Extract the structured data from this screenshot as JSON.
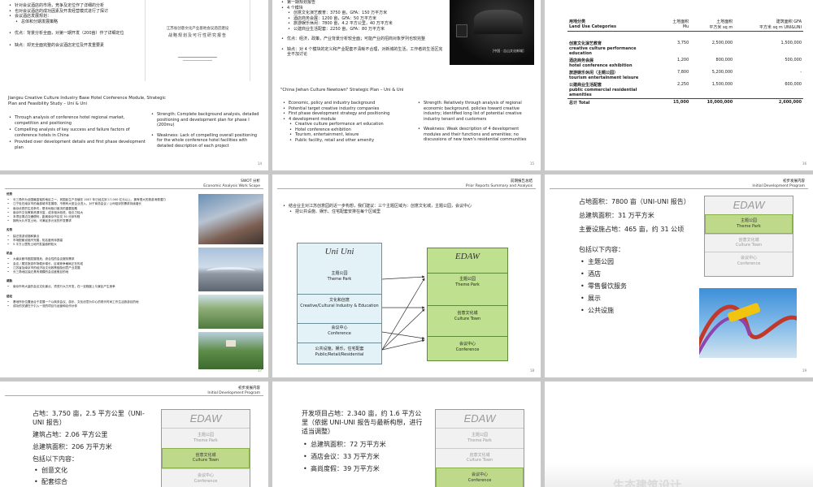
{
  "p1": {
    "bullets_cn": [
      "针对会议酒店的市场，竞争及定位作了详细的分析",
      "也对会议酒店的成功因素及开发经营模式进行了探讨",
      "会议酒店发展规划："
    ],
    "sub_cn": "总体和分期发展策略",
    "strength_cn": "优点：背景分析全面，对第一期开发（200亩）作了详细定位",
    "weak_cn": "缺点：却无全面完整的会议酒店定位及开发重要素",
    "cover_title": "江苏省创意文化产业基地会议酒店建设",
    "cover_sub": "战略规划及可行性研究报告",
    "heading": "Jiangsu Creative Culture Industry Base Hotel Conference Module, Strategic Plan and Feasibility Study – Uni & Uni",
    "en_bullets": [
      "Through analysis of conference hotel regional market, competition and positioning",
      "Compelling analysis of key success and failure factors of conference hotels in China",
      "Provided over development details and first phase development plan"
    ],
    "strength_en": "Strength: Complete background analysis, detailed positioning and development plan for phase I (200mu)",
    "weak_en": "Weakness: Lack of compelling overall positioning for the whole conference hotel facilities with detailed description of each project",
    "page": "14"
  },
  "p2": {
    "top_cn": "第一期规划报告",
    "mod_cn": "4 个模块",
    "mods_cn": [
      "创意文化演艺教育：3750 亩，GFA：150 万平方米",
      "酒店商务会展：1200 亩，GFA：50 万平方米",
      "旅游娱乐休闲：7800 亩，4.2 平方公里，40 万平方米",
      "公建商业生活配套：2250 亩，GFA：80 万平方米"
    ],
    "strength_cn": "优点：经济，政策，产业背景分析较全面；可能产业的招商对象罗列也较完整",
    "weak_cn": "缺点：对 4 个模块的定义和产业配套不清晰不合理，对新城的生活，工作者的生活区完全不加讨论",
    "photo_caption": "［中国 · 吉山文化新城］",
    "heading": "\"China Jiehan Culture Newtown\" Strategic Plan – Uni & Uni",
    "en_bullets": [
      "Economic, policy and industry background",
      "Potential target creative industry companies",
      "First phase development strategy and positioning",
      "4 development module"
    ],
    "en_sub": [
      "Creative culture performance art education",
      "Hotel conference exhibition",
      "Tourism, entertainment, leisure",
      "Public facility, retail and other amenity"
    ],
    "strength_en": "Strength: Relatively through analysis of regional economic background, policies toward creative industry; identified long list of potential creative industry tenant and customers",
    "weak_en": "Weakness: Weak description of 4 development modules and their functions and amenities; no discussions of new town's residential communities",
    "page": "15"
  },
  "p3": {
    "col_headers": [
      {
        "cn": "用地分类",
        "en": "Land Use Categories"
      },
      {
        "cn": "土地面积",
        "en": "Mu"
      },
      {
        "cn": "土地面积",
        "en": "平方米 sq m"
      },
      {
        "cn": "建筑面积 GFA",
        "en": "平方米 sq m UNI&UNI"
      }
    ],
    "rows": [
      {
        "cn": "创意文化演艺教育",
        "en": "creative culture performance education",
        "mu": "3,750",
        "sqm": "2,500,000",
        "gfa": "1,500,000"
      },
      {
        "cn": "酒店商务会展",
        "en": "hotel conference exhibition",
        "mu": "1,200",
        "sqm": "800,000",
        "gfa": "500,000"
      },
      {
        "cn": "旅游娱乐休闲（主题公园）",
        "en": "tourism entertainment leisure",
        "mu": "7,800",
        "sqm": "5,200,000",
        "gfa": "-"
      },
      {
        "cn": "公建商业生活配套",
        "en": "public commercial residential amenities",
        "mu": "2,250",
        "sqm": "1,500,000",
        "gfa": "600,000"
      }
    ],
    "total": {
      "label": "总计 Total",
      "mu": "15,000",
      "sqm": "10,000,000",
      "gfa": "2,600,000"
    },
    "page": "16"
  },
  "p4": {
    "header_cn": "SWOT 分析",
    "header_en": "Economic Analysis Work Scope",
    "s_title": "优势",
    "s_items": [
      "长三角作为全国最富裕的地区之一，其国民生产总值在 2007 年已经达到 17,000 亿元以上，拥有很大的旅游消费潜力",
      "江宁处在南京市的南部城市发展带，不断有大型企业进入，对于商务会议 / 公司培训的需求持续增长",
      "南京优质的生态条件，是本地吸引客流的重要因素",
      "南京市文化教育资源丰富，成本相对较低，吸引力较大",
      "本项目周边交通便利，距离南京市区仅 30 分钟车程",
      "拥有大片开发土地，可满足多元化的开发需求"
    ],
    "w_title": "劣势",
    "w_items": [
      "缺乏旅游设施和景点",
      "市场配套设施不完善，知名度有待提高",
      "5 平方公里的土地开发量面积较大"
    ],
    "o_title": "机会",
    "o_items": [
      "大南京都市圈发展规划，综合性的会议服务需求",
      "会议 / 展览旅游市场稳步增长，区域竞争格局正在形成",
      "江苏省及南京市的经济及文化政策鼓励创意产业发展",
      "长三角地区缺乏具有规模的会议度假目的地"
    ],
    "t_title": "威胁",
    "t_items": [
      "南京市有大量的会议文化景点，须进行大力开发，在一定程度上与景区产生竞争"
    ],
    "c_title": "结论",
    "c_items": [
      "基地所处位置适合于发展一个以商务会议、游乐、文化创意为中心的现代时尚工作生活旅游目的地",
      "成功的关键在于引入一流的项目与运营和合作伙伴"
    ],
    "page": "17"
  },
  "p5": {
    "header_cn": "前期报告总结",
    "header_en": "Prior Reports Summary and Analysis",
    "intro": "结合业主对江苏创意园的近一步构想，我们建议：三个主题区域为：创意文化城，主题公园，会议中心",
    "intro2": "把公共设施、娱乐、住宅配套安排在每个区域里",
    "left_title": "Uni Uni",
    "left_boxes": [
      {
        "cn": "主题公园",
        "en": "Theme Park"
      },
      {
        "cn": "文化和创意",
        "en": "Creative/Cultural Industry & Education"
      },
      {
        "cn": "会议中心",
        "en": "Conference"
      },
      {
        "cn": "公共设施，娱乐，住宅配套",
        "en": "Public/Retail/Residential"
      }
    ],
    "right_title": "EDAW",
    "right_boxes": [
      {
        "cn": "主题公园",
        "en": "Theme Park"
      },
      {
        "cn": "创意文化城",
        "en": "Culture Town"
      },
      {
        "cn": "会议中心",
        "en": "Conference"
      }
    ],
    "page": "18"
  },
  "p6": {
    "header_cn": "初步发展内容",
    "header_en": "Initial Development Program",
    "land": "占地面积：7800 亩（UNI-UNI 报告）",
    "gfa": "总建筑面积：31 万平方米",
    "facilities": "主要设施占地：465 亩，约 31 公顷",
    "includes": "包括以下内容：",
    "items": [
      "主题公园",
      "酒店",
      "零售餐饮服务",
      "展示",
      "公共设施"
    ],
    "panel_title": "EDAW",
    "panel_cells": [
      {
        "cn": "主题公园",
        "en": "Theme Park"
      },
      {
        "cn": "创意文化城",
        "en": "Culture Town"
      },
      {
        "cn": "会议中心",
        "en": "Conference"
      }
    ],
    "page": "19"
  },
  "p7": {
    "header_cn": "初步发展内容",
    "header_en": "Initial Development Program",
    "land": "占地：3,750 亩，2.5 平方公里（UNI-UNI 报告）",
    "building_land": "建筑占地：2.06 平方公里",
    "gfa": "总建筑面积：206 万平方米",
    "includes": "包括以下内容：",
    "items": [
      "创意文化",
      "配套综合"
    ],
    "panel_title": "EDAW",
    "panel_cells": [
      {
        "cn": "主题公园",
        "en": "Theme Park"
      },
      {
        "cn": "创意文化城",
        "en": "Culture Town"
      },
      {
        "cn": "会议中心",
        "en": "Conference"
      }
    ]
  },
  "p8": {
    "land": "开发项目占地：2.340 亩，约 1.6 平方公里（依据 UNI-UNI 报告与最新构想，进行适当调整）",
    "items": [
      "总建筑面积：72 万平方米",
      "酒店会议：33 万平方米",
      "高尚度假：39 万平方米"
    ],
    "panel_title": "EDAW",
    "panel_cells": [
      {
        "cn": "主题公园",
        "en": "Theme Park"
      },
      {
        "cn": "创意文化城",
        "en": "Culture Town"
      },
      {
        "cn": "会议中心",
        "en": "Conference"
      }
    ]
  },
  "p9": {
    "partial_title": "生态建筑设计"
  }
}
